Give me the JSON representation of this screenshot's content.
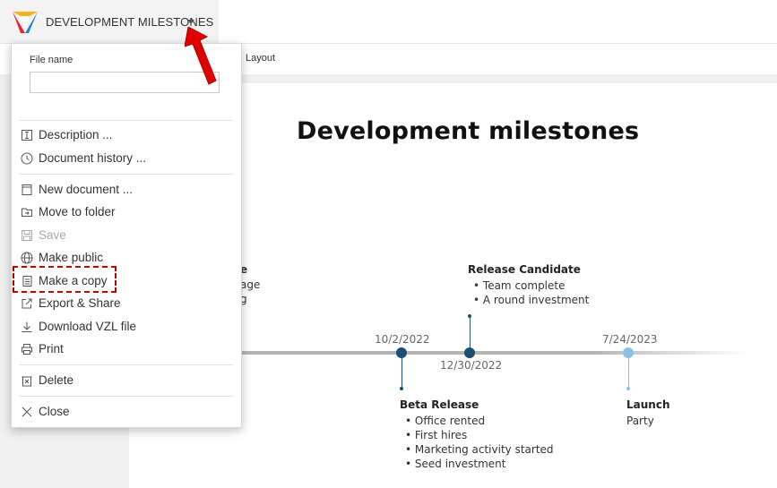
{
  "header": {
    "document_title": "DEVELOPMENT MILESTONES",
    "brand_colors": [
      "#e8262b",
      "#1e88c7",
      "#f6b31b"
    ]
  },
  "ribbon": {
    "tabs": [
      "Layout"
    ]
  },
  "menu": {
    "file_name_label": "File name",
    "file_name_value": "",
    "items": [
      {
        "label": "Description ...",
        "icon": "text-cursor-icon",
        "enabled": true
      },
      {
        "label": "Document history ...",
        "icon": "clock-icon",
        "enabled": true
      },
      {
        "label": "New document ...",
        "icon": "new-document-icon",
        "enabled": true
      },
      {
        "label": "Move to folder",
        "icon": "move-folder-icon",
        "enabled": true
      },
      {
        "label": "Save",
        "icon": "save-icon",
        "enabled": false
      },
      {
        "label": "Make public",
        "icon": "globe-icon",
        "enabled": true
      },
      {
        "label": "Make a copy",
        "icon": "copy-icon",
        "enabled": true,
        "highlighted": true
      },
      {
        "label": "Export & Share",
        "icon": "export-icon",
        "enabled": true
      },
      {
        "label": "Download VZL file",
        "icon": "download-icon",
        "enabled": true
      },
      {
        "label": "Print",
        "icon": "print-icon",
        "enabled": true
      },
      {
        "label": "Delete",
        "icon": "delete-icon",
        "enabled": true
      },
      {
        "label": "Close",
        "icon": "close-icon",
        "enabled": true
      }
    ]
  },
  "timeline": {
    "title": "Development milestones",
    "partial_text": [
      "e",
      "age",
      "g"
    ],
    "milestones": [
      {
        "date": "10/2/2022",
        "title": "Beta Release",
        "bullets": [
          "Office rented",
          "First hires",
          "Marketing activity started",
          "Seed investment"
        ],
        "color": "#1d4e74"
      },
      {
        "date": "12/30/2022",
        "title": "Release Candidate",
        "bullets": [
          "Team complete",
          "A round investment"
        ],
        "color": "#1d4e74"
      },
      {
        "date": "7/24/2023",
        "title": "Launch",
        "text": "Party",
        "color": "#8cc2e8"
      }
    ]
  }
}
